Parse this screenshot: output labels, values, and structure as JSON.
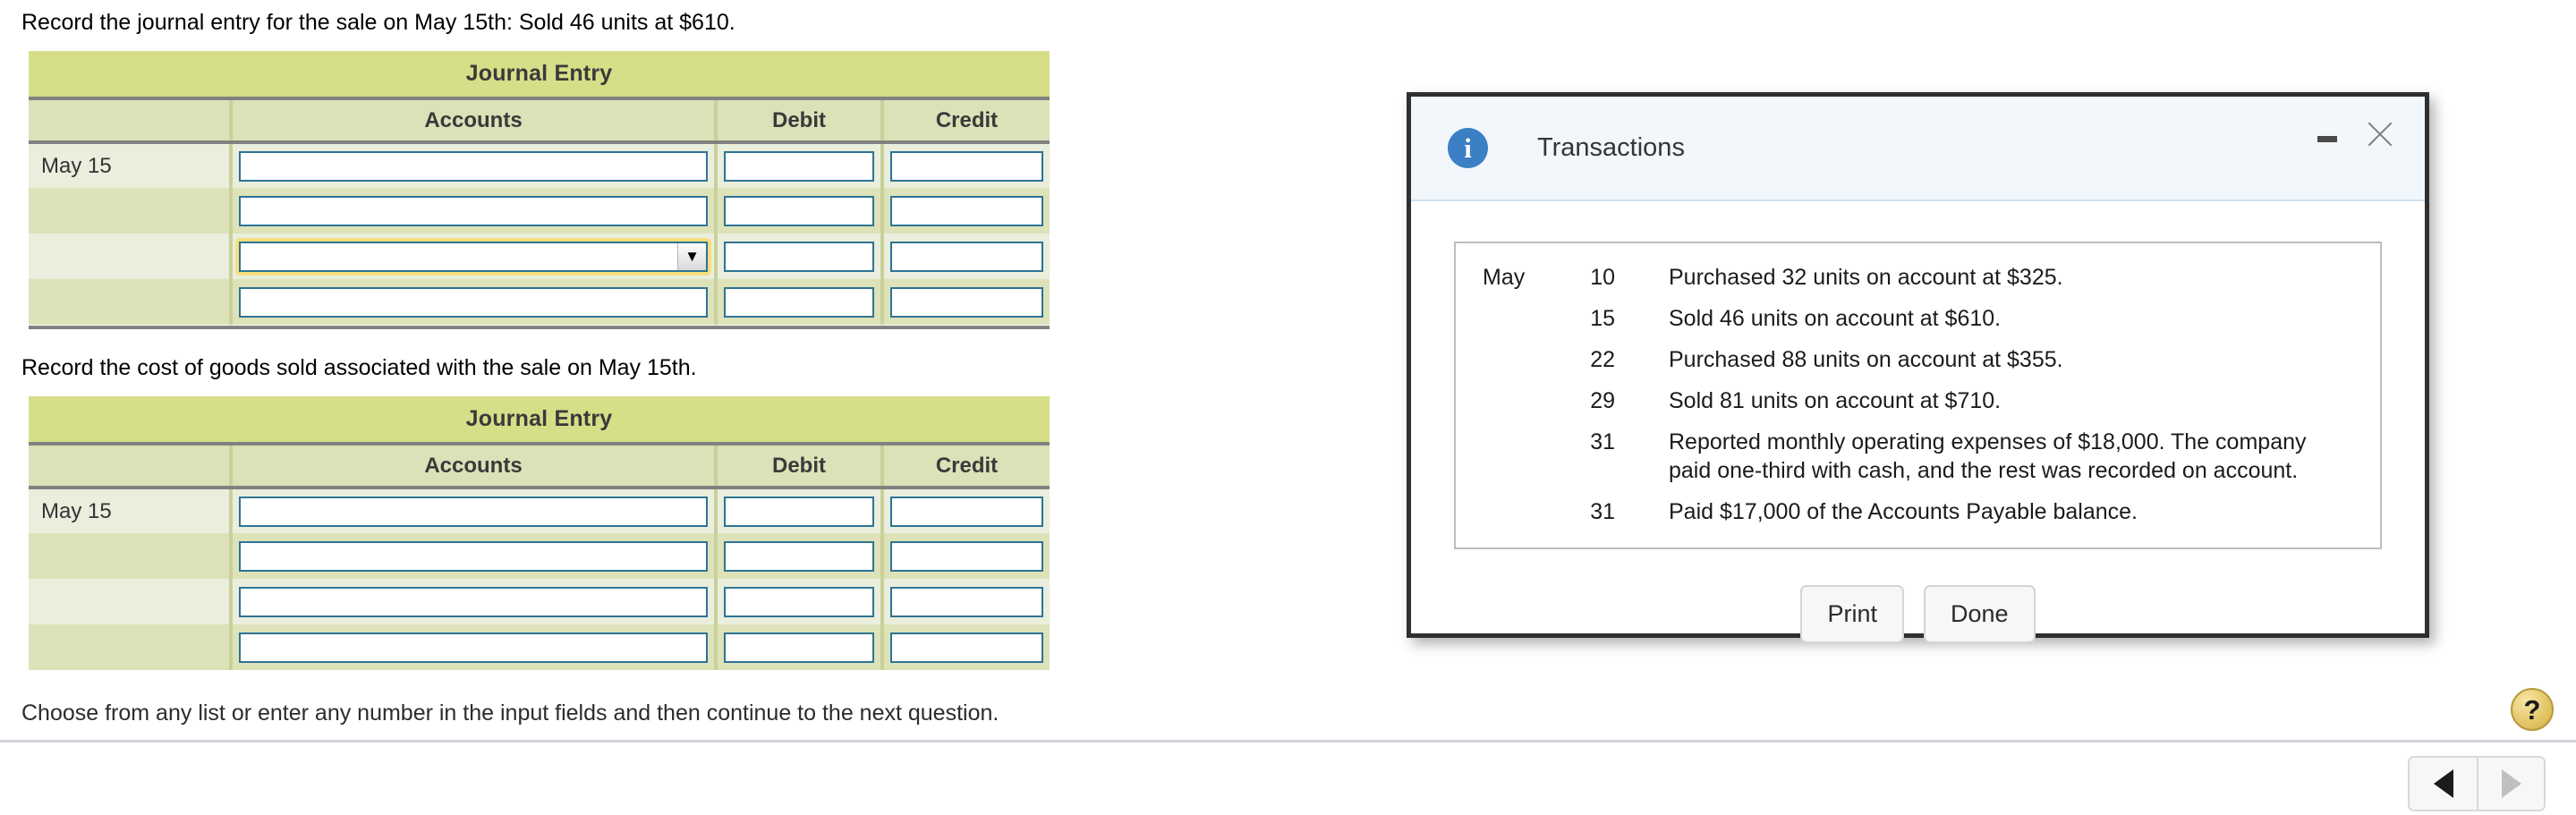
{
  "worksheet": {
    "prompt_1": "Record the journal entry for the sale on May 15th: Sold 46 units at $610.",
    "prompt_2": "Record the cost of goods sold associated with the sale on May 15th.",
    "tables": [
      {
        "title": "Journal Entry",
        "headers": {
          "date": "",
          "accounts": "Accounts",
          "debit": "Debit",
          "credit": "Credit"
        },
        "rows": [
          {
            "date": "May 15",
            "accounts": "",
            "debit": "",
            "credit": "",
            "control": "input"
          },
          {
            "date": "",
            "accounts": "",
            "debit": "",
            "credit": "",
            "control": "input"
          },
          {
            "date": "",
            "accounts": "",
            "debit": "",
            "credit": "",
            "control": "select"
          },
          {
            "date": "",
            "accounts": "",
            "debit": "",
            "credit": "",
            "control": "input"
          }
        ]
      },
      {
        "title": "Journal Entry",
        "headers": {
          "date": "",
          "accounts": "Accounts",
          "debit": "Debit",
          "credit": "Credit"
        },
        "rows": [
          {
            "date": "May 15",
            "accounts": "",
            "debit": "",
            "credit": "",
            "control": "input"
          },
          {
            "date": "",
            "accounts": "",
            "debit": "",
            "credit": "",
            "control": "input"
          },
          {
            "date": "",
            "accounts": "",
            "debit": "",
            "credit": "",
            "control": "input"
          },
          {
            "date": "",
            "accounts": "",
            "debit": "",
            "credit": "",
            "control": "input"
          }
        ]
      }
    ]
  },
  "dialog": {
    "icon": "info-icon",
    "title": "Transactions",
    "minimize_label": "minimize-icon",
    "close_label": "close-icon",
    "transactions": [
      {
        "month": "May",
        "day": "10",
        "description": "Purchased 32 units on account at $325."
      },
      {
        "month": "",
        "day": "15",
        "description": "Sold 46 units on account at $610."
      },
      {
        "month": "",
        "day": "22",
        "description": "Purchased 88 units on account at $355."
      },
      {
        "month": "",
        "day": "29",
        "description": "Sold 81 units on account at $710."
      },
      {
        "month": "",
        "day": "31",
        "description": "Reported monthly operating expenses of $18,000. The company paid one-third with cash, and the rest was recorded on account."
      },
      {
        "month": "",
        "day": "31",
        "description": "Paid $17,000 of the Accounts Payable balance."
      }
    ],
    "print_label": "Print",
    "done_label": "Done"
  },
  "footer": {
    "note": "Choose from any list or enter any number in the input fields and then continue to the next question.",
    "help_label": "?",
    "prev_label": "previous-arrow-icon",
    "next_label": "next-arrow-icon"
  },
  "colors": {
    "table_title_bg": "#d6de88",
    "table_header_bg": "#dce1b8",
    "row_light": "#e9eedd",
    "row_dark": "#dde2b9",
    "field_border": "#2e7394",
    "focus_glow": "#f7de7d",
    "dialog_border": "#2f2f2f",
    "dialog_header_bg": "#f2f7fc",
    "info_blue": "#3b7fc4",
    "help_gold": "#e0bf5c"
  }
}
